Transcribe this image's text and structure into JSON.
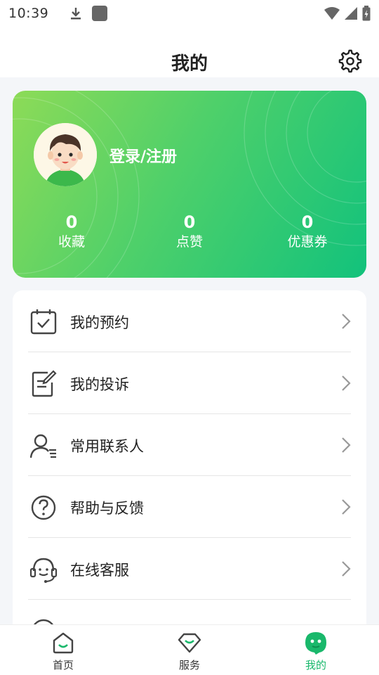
{
  "status_bar": {
    "time": "10:39",
    "icons": [
      "download-icon",
      "app-square-icon",
      "wifi-icon",
      "signal-icon",
      "battery-icon"
    ]
  },
  "header": {
    "title": "我的",
    "settings_icon": "gear-icon"
  },
  "profile": {
    "login_text": "登录/注册",
    "avatar_icon": "boy-avatar-icon",
    "gradient_colors": [
      "#8ddb57",
      "#12c27c"
    ],
    "stats": [
      {
        "value": "0",
        "label": "收藏"
      },
      {
        "value": "0",
        "label": "点赞"
      },
      {
        "value": "0",
        "label": "优惠券"
      }
    ]
  },
  "menu": {
    "items": [
      {
        "label": "我的预约",
        "icon": "calendar-check-icon"
      },
      {
        "label": "我的投诉",
        "icon": "edit-note-icon"
      },
      {
        "label": "常用联系人",
        "icon": "contacts-icon"
      },
      {
        "label": "帮助与反馈",
        "icon": "help-circle-icon"
      },
      {
        "label": "在线客服",
        "icon": "headset-icon"
      }
    ]
  },
  "tab_bar": {
    "accent_color": "#18b86b",
    "tabs": [
      {
        "label": "首页",
        "icon": "home-icon",
        "active": false
      },
      {
        "label": "服务",
        "icon": "service-gem-icon",
        "active": false
      },
      {
        "label": "我的",
        "icon": "mine-face-icon",
        "active": true
      }
    ]
  }
}
